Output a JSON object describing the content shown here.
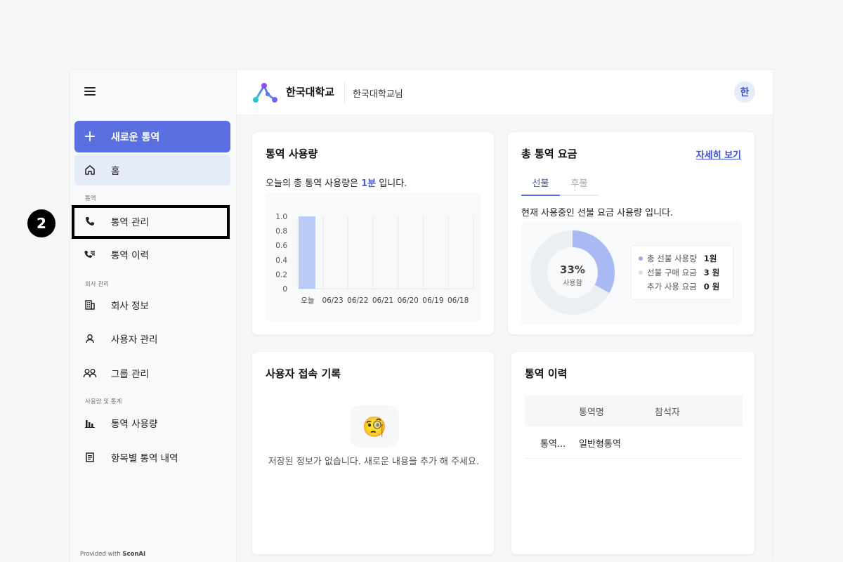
{
  "sidebar": {
    "new_call": "새로운 통역",
    "home": "홈",
    "section_call": "통역",
    "call_manage": "통역 관리",
    "call_history": "통역 이력",
    "section_company": "회사 관리",
    "company_info": "회사 정보",
    "user_manage": "사용자 관리",
    "group_manage": "그룹 관리",
    "section_stats": "사용량 및 통계",
    "usage": "통역 사용량",
    "item_history": "항목별 통역 내역",
    "provided_prefix": "Provided with ",
    "provided_brand": "SconAI"
  },
  "step_badge": "2",
  "header": {
    "org_name": "한국대학교",
    "user_name": "한국대학교님",
    "avatar": "한"
  },
  "usage_card": {
    "title": "통역 사용량",
    "text_prefix": "오늘의 총 통역 사용량은 ",
    "text_value": "1분",
    "text_suffix": " 입니다."
  },
  "fee_card": {
    "title": "총 통역 요금",
    "more": "자세히 보기",
    "tab_prepaid": "선불",
    "tab_postpaid": "후불",
    "desc": "현재 사용중인 선불 요금 사용량 입니다.",
    "donut_percent": "33%",
    "donut_label": "사용함",
    "used_fraction": 0.33,
    "legend": [
      {
        "label": "총 선불 사용량",
        "value": "1원",
        "color": "#9aaaf0"
      },
      {
        "label": "선불 구매 요금",
        "value": "3 원",
        "color": "#d9dce3"
      },
      {
        "label": "추가 사용 요금",
        "value": "0 원",
        "color": ""
      }
    ]
  },
  "access_card": {
    "title": "사용자 접속 기록",
    "empty_icon": "🧐",
    "empty_text": "저장된 정보가 없습니다. 새로운 내용을 추가 해 주세요."
  },
  "history_card": {
    "title": "통역 이력",
    "col_name": "통역명",
    "col_participants": "참석자",
    "row_first": "통역...",
    "row_name": "일반형통역",
    "row_participants": ""
  },
  "chart_data": {
    "type": "bar",
    "categories": [
      "오늘",
      "06/23",
      "06/22",
      "06/21",
      "06/20",
      "06/19",
      "06/18"
    ],
    "values": [
      1.0,
      0,
      0,
      0,
      0,
      0,
      0
    ],
    "yticks": [
      "1.0",
      "0.8",
      "0.6",
      "0.4",
      "0.2",
      "0"
    ],
    "ylim": [
      0,
      1.0
    ],
    "bar_color": "#bccbf5",
    "grid": true
  }
}
